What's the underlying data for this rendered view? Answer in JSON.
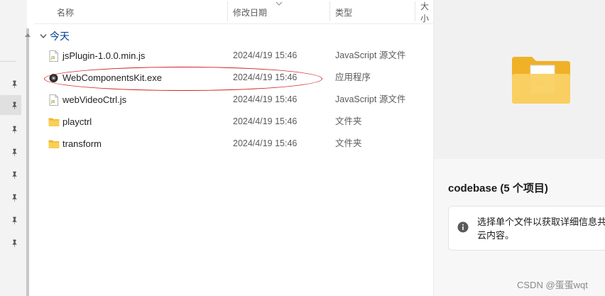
{
  "columns": {
    "name": "名称",
    "date": "修改日期",
    "type": "类型",
    "size": "大小"
  },
  "group": {
    "label": "今天"
  },
  "files": [
    {
      "name": "jsPlugin-1.0.0.min.js",
      "date": "2024/4/19 15:46",
      "type": "JavaScript 源文件",
      "icon": "js-file-icon"
    },
    {
      "name": "WebComponentsKit.exe",
      "date": "2024/4/19 15:46",
      "type": "应用程序",
      "icon": "exe-file-icon"
    },
    {
      "name": "webVideoCtrl.js",
      "date": "2024/4/19 15:46",
      "type": "JavaScript 源文件",
      "icon": "js-file-icon"
    },
    {
      "name": "playctrl",
      "date": "2024/4/19 15:46",
      "type": "文件夹",
      "icon": "folder-icon"
    },
    {
      "name": "transform",
      "date": "2024/4/19 15:46",
      "type": "文件夹",
      "icon": "folder-icon"
    }
  ],
  "details": {
    "title": "codebase (5 个项目)",
    "info": "选择单个文件以获取详细信息共享云内容。"
  },
  "watermark": "CSDN @蛋蛋wqt",
  "colors": {
    "accent": "#003e92",
    "highlight_ring": "#d32020",
    "folder": "#f8c845"
  }
}
